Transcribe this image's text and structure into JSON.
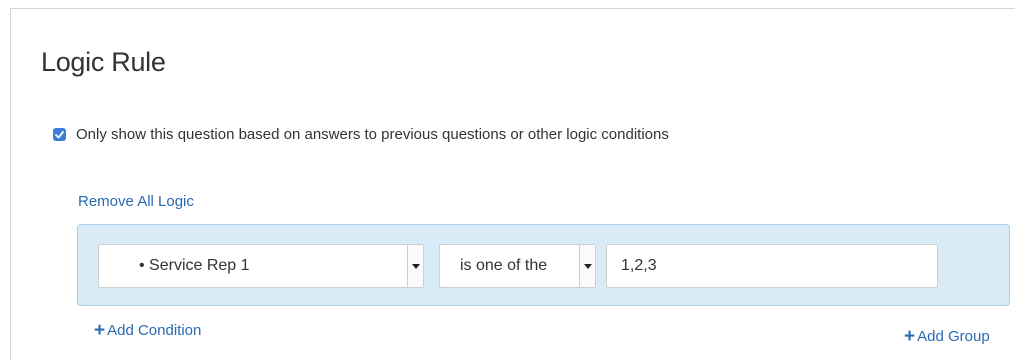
{
  "panel": {
    "title": "Logic Rule"
  },
  "logic_toggle": {
    "checked": true,
    "label": "Only show this question based on answers to previous questions or other logic conditions"
  },
  "actions": {
    "remove_all_label": "Remove All Logic",
    "add_condition_label": "Add Condition",
    "add_group_label": "Add Group",
    "plus_symbol": "+"
  },
  "condition": {
    "question": "• Service Rep 1",
    "operator": "is one of the",
    "value": "1,2,3"
  },
  "colors": {
    "accent": "#3a7dd8",
    "link": "#2a6bb0",
    "logic_box_bg": "#d9ebf7",
    "logic_box_border": "#aacde6"
  }
}
